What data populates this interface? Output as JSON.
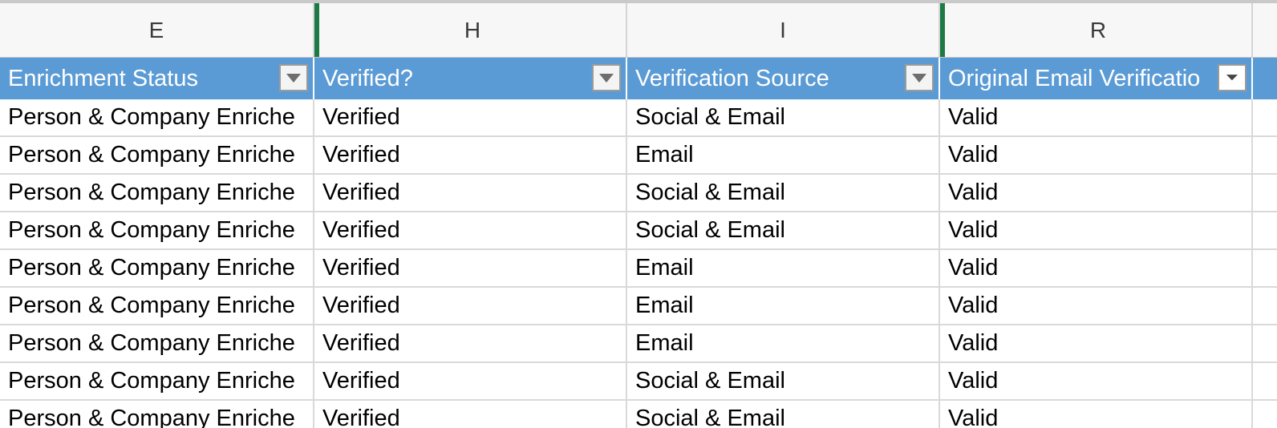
{
  "columns": {
    "letters": [
      "E",
      "H",
      "I",
      "R"
    ],
    "headers": [
      "Enrichment Status",
      "Verified?",
      "Verification Source",
      "Original Email Verificatio"
    ]
  },
  "rows": [
    [
      "Person & Company Enriche",
      "Verified",
      "Social & Email",
      "Valid"
    ],
    [
      "Person & Company Enriche",
      "Verified",
      "Email",
      "Valid"
    ],
    [
      "Person & Company Enriche",
      "Verified",
      "Social & Email",
      "Valid"
    ],
    [
      "Person & Company Enriche",
      "Verified",
      "Social & Email",
      "Valid"
    ],
    [
      "Person & Company Enriche",
      "Verified",
      "Email",
      "Valid"
    ],
    [
      "Person & Company Enriche",
      "Verified",
      "Email",
      "Valid"
    ],
    [
      "Person & Company Enriche",
      "Verified",
      "Email",
      "Valid"
    ],
    [
      "Person & Company Enriche",
      "Verified",
      "Social & Email",
      "Valid"
    ],
    [
      "Person & Company Enriche",
      "Verified",
      "Social & Email",
      "Valid"
    ]
  ],
  "icons": {
    "filter": "dropdown-arrow-icon",
    "active_filter": "funnel-filter-icon"
  },
  "colors": {
    "header_blue": "#5b9bd5",
    "column_gap_green": "#1e7a45"
  }
}
